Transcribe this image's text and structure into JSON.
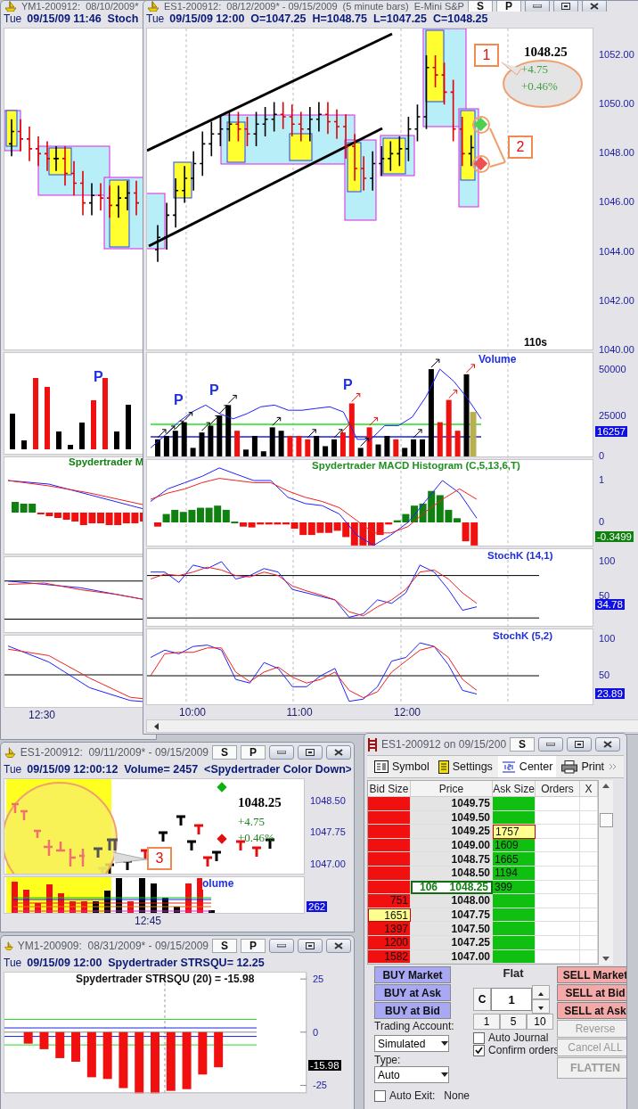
{
  "left_window": {
    "title": "YM1-200912:  08/10/2009*",
    "day": "Tue",
    "header": "09/15/09 11:46  Stoch",
    "volume_marker": "P",
    "indicator_title": "Spydertrader M",
    "time_label": "12:30"
  },
  "main_window": {
    "title": "ES1-200912:  08/12/2009* - 09/15/2009  (5 minute bars)  E-Mini S&P",
    "buttons": [
      "S",
      "P"
    ],
    "day": "Tue",
    "header": "09/15/09 12:00  O=1047.25  H=1048.75  L=1047.25  C=1048.25",
    "price_panel": {
      "axis": [
        "1052.00",
        "1050.00",
        "1048.00",
        "1046.00",
        "1044.00",
        "1042.00",
        "1040.00"
      ],
      "price": "1048.25",
      "change": "+4.75",
      "change_pct": "+0.46%",
      "callouts": [
        "1",
        "2"
      ],
      "interval": "110s"
    },
    "volume_panel": {
      "title": "Volume",
      "markers": [
        "P",
        "P",
        "P"
      ],
      "axis": [
        "50000",
        "25000",
        "0"
      ],
      "reading": "16257"
    },
    "macd_panel": {
      "title": "Spydertrader MACD Histogram (C,5,13,6,T)",
      "axis": [
        "1",
        "0"
      ],
      "reading": "-0.3499"
    },
    "stoch_panels": [
      {
        "title": "StochK (14,1)",
        "axis": [
          "100",
          "50"
        ],
        "reading": "34.78"
      },
      {
        "title": "StochK (5,2)",
        "axis": [
          "100",
          "50"
        ],
        "reading": "23.89"
      }
    ],
    "time_axis": [
      "10:00",
      "11:00",
      "12:00"
    ]
  },
  "small_window": {
    "title": "ES1-200912:  09/11/2009* - 09/15/2009",
    "buttons": [
      "S",
      "P"
    ],
    "day": "Tue",
    "header": "09/15/09 12:00:12  Volume= 2457  <Spydertrader Color Down>",
    "price": "1048.25",
    "change": "+4.75",
    "change_pct": "+0.46%",
    "axis": [
      "1048.50",
      "1047.75",
      "1047.00"
    ],
    "callout": "3",
    "volume_title": "olume",
    "reading": "262",
    "time_label": "12:45"
  },
  "strsqu_window": {
    "title": "YM1-200909:  08/31/2009* - 09/15/2009",
    "buttons": [
      "S",
      "P"
    ],
    "day": "Tue",
    "header": "09/15/09 12:00  Spydertrader STRSQU= 12.25",
    "reading": "-15.98",
    "chart_data": {
      "type": "bar",
      "title": "Spydertrader STRSQU (20) = -15.98",
      "categories": [
        null,
        null,
        null,
        null,
        null,
        null,
        null,
        null,
        null,
        null,
        null,
        null,
        null,
        null,
        null,
        null,
        null,
        null,
        null
      ],
      "values": [
        null,
        -5.4,
        -8,
        -12.2,
        -13.9,
        -21.2,
        -22,
        -26.3,
        -28.8,
        -28.8,
        -27.6,
        -26.8,
        -19.9,
        -16.5,
        null,
        null,
        null,
        null,
        null
      ],
      "ylim": [
        -29,
        28
      ],
      "yticks": [
        25,
        0,
        -25
      ]
    }
  },
  "dom": {
    "title": "ES1-200912 on 09/15/200",
    "buttons": [
      "S"
    ],
    "toolbar": [
      {
        "label": "Symbol",
        "kind": "symbol"
      },
      {
        "label": "Settings",
        "kind": "settings"
      },
      {
        "label": "Center",
        "kind": "center"
      },
      {
        "label": "Print",
        "kind": "print"
      }
    ],
    "columns": [
      "Bid Size",
      "Price",
      "Ask Size",
      "Orders",
      "X"
    ],
    "rows": [
      {
        "price": "1049.75",
        "kind": "level",
        "bid_flash": false,
        "ask_flash": false
      },
      {
        "price": "1049.50",
        "kind": "level",
        "bid_flash": false,
        "ask_flash": false
      },
      {
        "price": "1049.25",
        "ask": "1757",
        "kind": "level",
        "bid_flash": false,
        "ask_flash": true
      },
      {
        "price": "1049.00",
        "ask": "1609",
        "kind": "level",
        "bid_flash": false,
        "ask_flash": false
      },
      {
        "price": "1048.75",
        "ask": "1665",
        "kind": "level",
        "bid_flash": false,
        "ask_flash": false
      },
      {
        "price": "1048.50",
        "ask": "1194",
        "kind": "level",
        "bid_flash": false,
        "ask_flash": false
      },
      {
        "price": "1048.25",
        "ask": "399",
        "last_size": "106",
        "kind": "last",
        "bid_flash": false,
        "ask_flash": false
      },
      {
        "price": "1048.00",
        "bid": "751",
        "kind": "level",
        "bid_flash": false,
        "ask_flash": false
      },
      {
        "price": "1047.75",
        "bid": "1651",
        "kind": "level",
        "bid_flash": true,
        "ask_flash": false
      },
      {
        "price": "1047.50",
        "bid": "1397",
        "kind": "level",
        "bid_flash": false,
        "ask_flash": false
      },
      {
        "price": "1047.25",
        "bid": "1200",
        "kind": "level",
        "bid_flash": false,
        "ask_flash": false
      },
      {
        "price": "1047.00",
        "bid": "1582",
        "kind": "level",
        "bid_flash": false,
        "ask_flash": false
      }
    ],
    "buy_buttons": [
      "BUY Market",
      "BUY at Ask",
      "BUY at Bid"
    ],
    "position": "Flat",
    "clear_button": "C",
    "quantity": "1",
    "quick_quantities": [
      "1",
      "5",
      "10"
    ],
    "sell_buttons": [
      "SELL Market",
      "SELL at Bid",
      "SELL at Ask"
    ],
    "actions": [
      {
        "label": "Reverse",
        "disabled": true
      },
      {
        "label": "Cancel ALL",
        "disabled": true
      },
      {
        "label": "FLATTEN",
        "disabled": true
      }
    ],
    "account_label": "Trading Account:",
    "account": "Simulated",
    "type_label": "Type:",
    "type": "Auto",
    "options": [
      {
        "label": "Auto Journal",
        "checked": false
      },
      {
        "label": "Confirm orders",
        "checked": true
      }
    ],
    "auto_exit": {
      "label": "Auto Exit:",
      "checked": false,
      "value": "None"
    }
  }
}
